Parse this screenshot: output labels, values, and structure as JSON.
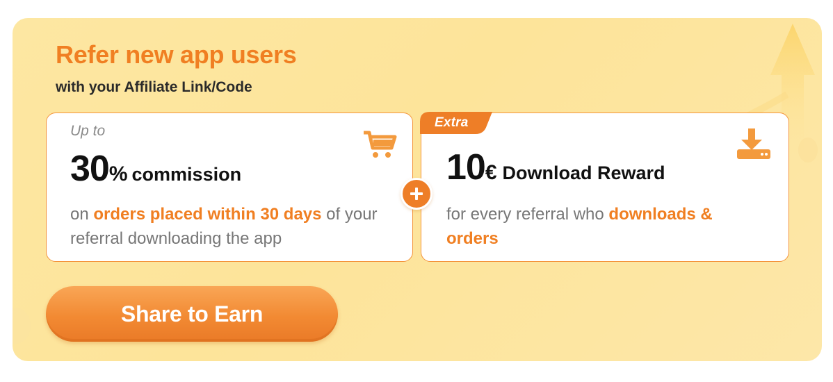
{
  "banner": {
    "title": "Refer new app users",
    "subtitle": "with your Affiliate Link/Code"
  },
  "commission_card": {
    "prefix": "Up to",
    "amount": "30",
    "unit": "%",
    "word": "commission",
    "desc_before": "on ",
    "desc_highlight": "orders placed within 30 days",
    "desc_after": " of your referral downloading the app",
    "icon": "shopping-cart-icon"
  },
  "plus_symbol": "+",
  "reward_card": {
    "tag": "Extra",
    "amount": "10",
    "unit": "€",
    "word": "Download Reward",
    "desc_before": "for every referral who ",
    "desc_highlight": "downloads & orders",
    "icon": "download-icon"
  },
  "share_button": {
    "label": "Share to Earn"
  },
  "colors": {
    "accent": "#f07f22",
    "background": "#fde7a2",
    "card_border": "#f4953c",
    "text_dark": "#111111",
    "text_muted": "#777777"
  }
}
